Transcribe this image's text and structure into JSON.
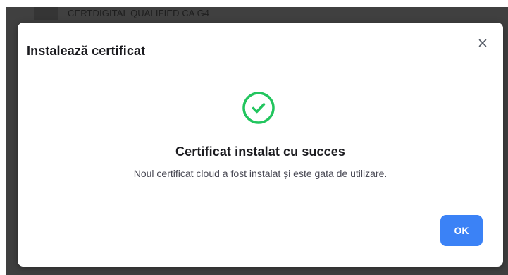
{
  "background": {
    "list_item_text": "CERTDIGITAL QUALIFIED CA G4"
  },
  "dialog": {
    "title": "Instalează certificat",
    "close_icon": "close-icon",
    "success_icon": "check-circle-icon",
    "success_heading": "Certificat instalat cu succes",
    "success_message": "Noul certificat cloud a fost instalat și este gata de utilizare.",
    "ok_label": "OK"
  },
  "colors": {
    "backdrop": "#3f3f3f",
    "success": "#22c55e",
    "primary": "#3b82f6"
  }
}
